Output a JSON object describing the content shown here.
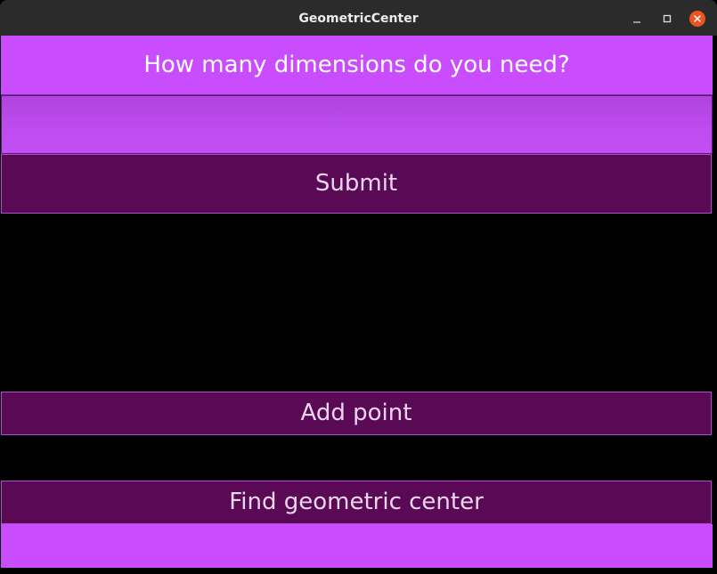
{
  "window": {
    "title": "GeometricCenter",
    "controls": {
      "minimize": "minimize-icon",
      "maximize": "maximize-icon",
      "close": "close-icon"
    }
  },
  "main": {
    "prompt": "How many dimensions do you need?",
    "dimensions_input": {
      "value": "",
      "placeholder": ""
    },
    "submit_label": "Submit",
    "add_point_label": "Add point",
    "find_center_label": "Find geometric center",
    "result_text": ""
  },
  "colors": {
    "titlebar": "#2b2b2b",
    "prompt_background": "#c94dff",
    "button_background": "#5a0a55",
    "button_border": "#b44ad6",
    "button_text": "#ead6ee",
    "close_button": "#e95420",
    "page_background": "#000000"
  }
}
